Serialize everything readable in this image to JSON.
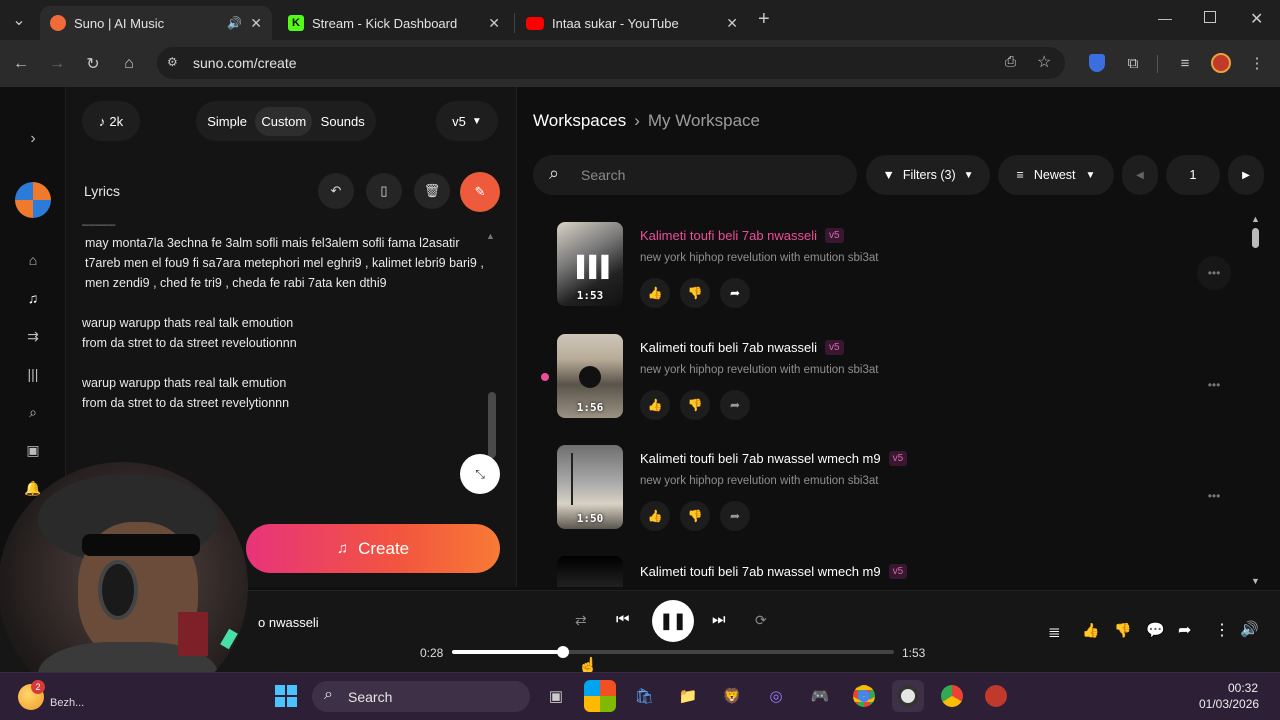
{
  "tabs": [
    {
      "title": "Suno | AI Music",
      "active": true,
      "favicon_color": "#f06a3a"
    },
    {
      "title": "Stream - Kick Dashboard",
      "active": false,
      "favicon_color": "#53fc18"
    },
    {
      "title": "Intaa sukar - YouTube",
      "active": false,
      "favicon_color": "#ff0000"
    }
  ],
  "address": {
    "url": "suno.com/create"
  },
  "left": {
    "credits": "2k",
    "modes": [
      "Simple",
      "Custom",
      "Sounds"
    ],
    "model": "v5",
    "lyrics_label": "Lyrics",
    "lyrics_lines": [
      "may monta7la 3echna fe 3alm sofli mais fel3alem sofli fama l2asatir t7areb men el fou9 fi sa7ara metephori mel eghri9 , kalimet lebri9 bari9 , men zendi9 , ched fe tri9 , cheda fe rabi 7ata ken dthi9",
      "warup warupp thats real talk emoution\nfrom da stret to da street reveloutionnn",
      "warup warupp thats real talk emution\nfrom da stret to da street revelytionnn"
    ],
    "create_label": "Create"
  },
  "workspace": {
    "root": "Workspaces",
    "current": "My Workspace"
  },
  "toolbar": {
    "search_placeholder": "Search",
    "filters": "Filters (3)",
    "sort": "Newest",
    "page": "1"
  },
  "songs": [
    {
      "title": "Kalimeti toufi beli 7ab nwasseli",
      "badge": "v5",
      "desc": "new york hiphop revelution with emution sbi3at",
      "duration": "1:53",
      "playing": true,
      "title_color": "#ee4d9b"
    },
    {
      "title": "Kalimeti toufi beli 7ab nwasseli",
      "badge": "v5",
      "desc": "new york hiphop revelution with emution sbi3at",
      "duration": "1:56",
      "playing": false,
      "title_color": "#ffffff"
    },
    {
      "title": "Kalimeti toufi beli 7ab nwassel wmech m9",
      "badge": "v5",
      "desc": "new york hiphop revelution with emution sbi3at",
      "duration": "1:50",
      "playing": false,
      "title_color": "#ffffff"
    },
    {
      "title": "Kalimeti toufi beli 7ab nwassel wmech m9",
      "badge": "v5",
      "desc": "",
      "duration": "",
      "playing": false,
      "title_color": "#ffffff"
    }
  ],
  "player": {
    "track_fragment": "o nwasseli",
    "elapsed": "0:28",
    "total": "1:53",
    "progress": 0.25
  },
  "taskbar": {
    "search": "Search",
    "weather_label": "Bezh...",
    "weather_badge": "2",
    "time": "00:32",
    "date": "01/03/2026"
  }
}
